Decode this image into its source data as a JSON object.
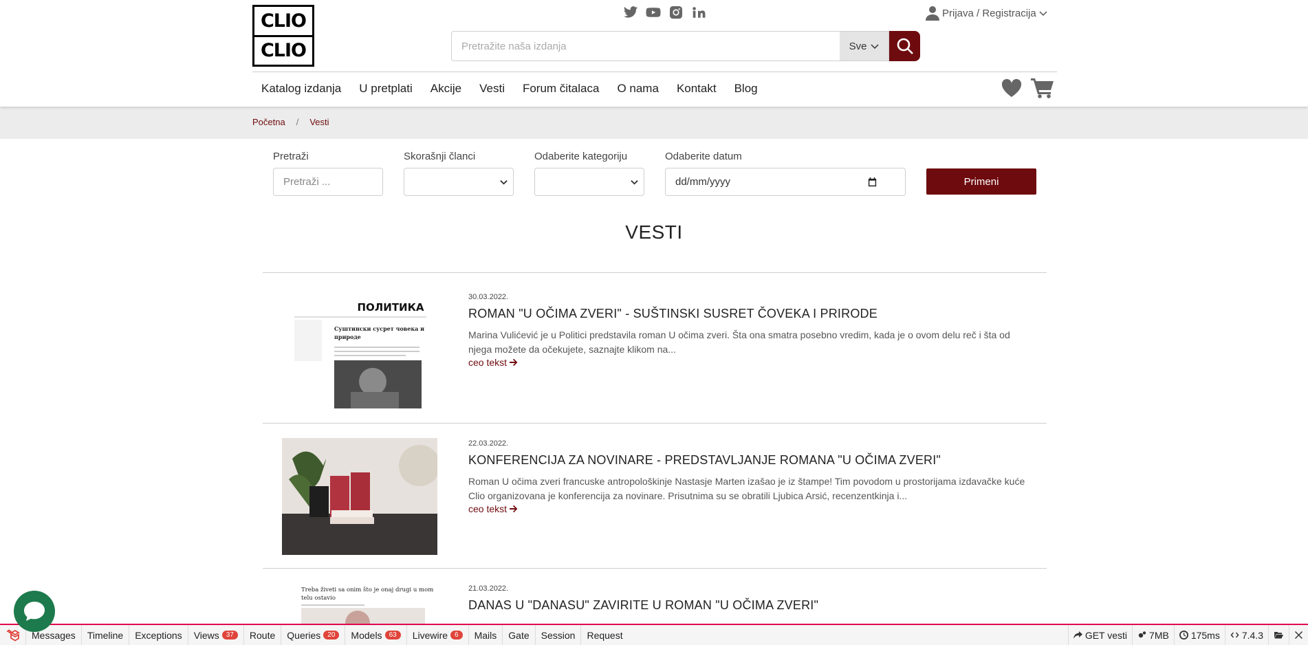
{
  "header": {
    "logo_text": [
      "CLIO",
      "CLIO"
    ],
    "socials": [
      "twitter-icon",
      "youtube-icon",
      "instagram-icon",
      "linkedin-icon"
    ],
    "account_label": "Prijava / Registracija",
    "search": {
      "placeholder": "Pretražite naša izdanja",
      "scope_label": "Sve"
    },
    "nav": [
      "Katalog izdanja",
      "U pretplati",
      "Akcije",
      "Vesti",
      "Forum čitalaca",
      "O nama",
      "Kontakt",
      "Blog"
    ],
    "nav_icons": [
      "heart-icon",
      "cart-icon"
    ]
  },
  "breadcrumb": {
    "home": "Početna",
    "separator": "/",
    "current": "Vesti"
  },
  "filters": {
    "search_label": "Pretraži",
    "search_placeholder": "Pretraži ...",
    "recent_label": "Skorašnji članci",
    "category_label": "Odaberite kategoriju",
    "date_label": "Odaberite datum",
    "date_placeholder": "dd/mm/yyyy",
    "apply_label": "Primeni"
  },
  "page_title": "VESTI",
  "articles": [
    {
      "date": "30.03.2022.",
      "title": "ROMAN \"U OČIMA ZVERI\" - SUŠTINSKI SUSRET ČOVEKA I PRIRODE",
      "excerpt": "Marina Vulićević je u Politici predstavila roman U očima zveri. Šta ona smatra posebno vredim, kada je o ovom delu reč i šta od njega možete da očekujete, saznajte klikom na...",
      "more": "ceo tekst",
      "thumb_masthead": "ПОЛИТИКА",
      "thumb_headline": "Суштински сусрет човека и природе"
    },
    {
      "date": "22.03.2022.",
      "title": "KONFERENCIJA ZA NOVINARE - PREDSTAVLJANJE ROMANA \"U OČIMA ZVERI\"",
      "excerpt": "Roman U očima zveri francuske antropološkinje Nastasje Marten izašao je iz štampe! Tim povodom u prostorijama izdavačke kuće Clio organizovana je konferencija za novinare. Prisutnima su se obratili Ljubica Arsić, recenzentkinja i...",
      "more": "ceo tekst"
    },
    {
      "date": "21.03.2022.",
      "title": "DANAS U \"DANASU\" ZAVIRITE U ROMAN \"U OČIMA ZVERI\"",
      "thumb_headline": "Treba živeti sa onim što je onaj drugi u mom telu ostavio"
    }
  ],
  "debugbar": {
    "tabs": [
      {
        "label": "Messages"
      },
      {
        "label": "Timeline"
      },
      {
        "label": "Exceptions"
      },
      {
        "label": "Views",
        "badge": "37"
      },
      {
        "label": "Route"
      },
      {
        "label": "Queries",
        "badge": "20"
      },
      {
        "label": "Models",
        "badge": "63"
      },
      {
        "label": "Livewire",
        "badge": "6"
      },
      {
        "label": "Mails"
      },
      {
        "label": "Gate"
      },
      {
        "label": "Session"
      },
      {
        "label": "Request"
      }
    ],
    "route": "GET vesti",
    "memory": "7MB",
    "time": "175ms",
    "php_version": "7.4.3"
  },
  "colors": {
    "brand": "#6e0b0f",
    "chat": "#1d7a4c",
    "debug_accent": "#e0443a"
  }
}
